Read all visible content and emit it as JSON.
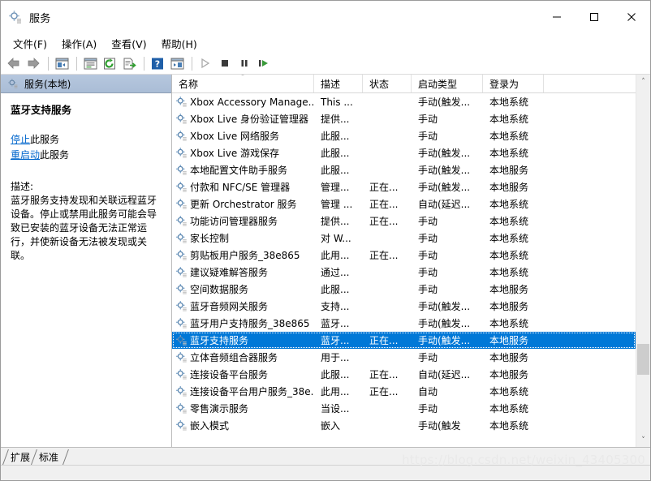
{
  "window": {
    "title": "服务",
    "icon": "services-gear-icon",
    "minimize_label": "—",
    "maximize_label": "☐",
    "close_label": "✕"
  },
  "menubar": [
    {
      "name": "file",
      "label": "文件(F)"
    },
    {
      "name": "action",
      "label": "操作(A)"
    },
    {
      "name": "view",
      "label": "查看(V)"
    },
    {
      "name": "help",
      "label": "帮助(H)"
    }
  ],
  "toolbar": [
    {
      "name": "back-icon",
      "type": "icon"
    },
    {
      "name": "forward-icon",
      "type": "icon"
    },
    {
      "name": "separator",
      "type": "sep"
    },
    {
      "name": "show-hide-tree-icon",
      "type": "icon"
    },
    {
      "name": "separator",
      "type": "sep"
    },
    {
      "name": "properties-icon",
      "type": "icon"
    },
    {
      "name": "refresh-icon",
      "type": "icon"
    },
    {
      "name": "export-list-icon",
      "type": "icon"
    },
    {
      "name": "separator",
      "type": "sep"
    },
    {
      "name": "help-icon",
      "type": "icon"
    },
    {
      "name": "show-action-pane-icon",
      "type": "icon"
    },
    {
      "name": "separator",
      "type": "sep"
    },
    {
      "name": "start-service-icon",
      "type": "icon"
    },
    {
      "name": "stop-service-icon",
      "type": "icon"
    },
    {
      "name": "pause-service-icon",
      "type": "icon"
    },
    {
      "name": "restart-service-icon",
      "type": "icon"
    }
  ],
  "left_pane": {
    "header": "服务(本地)",
    "header_icon": "services-gear-icon",
    "service_title": "蓝牙支持服务",
    "links": [
      {
        "name": "stop-service-link",
        "link_text": "停止",
        "suffix": "此服务"
      },
      {
        "name": "restart-service-link",
        "link_text": "重启动",
        "suffix": "此服务"
      }
    ],
    "description_label": "描述:",
    "description_text": "蓝牙服务支持发现和关联远程蓝牙设备。停止或禁用此服务可能会导致已安装的蓝牙设备无法正常运行，并使新设备无法被发现或关联。"
  },
  "list": {
    "columns": [
      {
        "name": "name",
        "label": "名称",
        "sorted": true
      },
      {
        "name": "description",
        "label": "描述",
        "sorted": false
      },
      {
        "name": "status",
        "label": "状态",
        "sorted": false
      },
      {
        "name": "startup_type",
        "label": "启动类型",
        "sorted": false
      },
      {
        "name": "log_on_as",
        "label": "登录为",
        "sorted": false
      }
    ],
    "sort_indicator": "˄",
    "rows": [
      {
        "name": "Xbox Accessory Manage...",
        "description": "This ...",
        "status": "",
        "startup_type": "手动(触发...",
        "log_on_as": "本地系统",
        "selected": false
      },
      {
        "name": "Xbox Live 身份验证管理器",
        "description": "提供...",
        "status": "",
        "startup_type": "手动",
        "log_on_as": "本地系统",
        "selected": false
      },
      {
        "name": "Xbox Live 网络服务",
        "description": "此服...",
        "status": "",
        "startup_type": "手动",
        "log_on_as": "本地系统",
        "selected": false
      },
      {
        "name": "Xbox Live 游戏保存",
        "description": "此服...",
        "status": "",
        "startup_type": "手动(触发...",
        "log_on_as": "本地系统",
        "selected": false
      },
      {
        "name": "本地配置文件助手服务",
        "description": "此服...",
        "status": "",
        "startup_type": "手动(触发...",
        "log_on_as": "本地服务",
        "selected": false
      },
      {
        "name": "付款和 NFC/SE 管理器",
        "description": "管理...",
        "status": "正在...",
        "startup_type": "手动(触发...",
        "log_on_as": "本地服务",
        "selected": false
      },
      {
        "name": "更新 Orchestrator 服务",
        "description": "管理 ...",
        "status": "正在...",
        "startup_type": "自动(延迟...",
        "log_on_as": "本地系统",
        "selected": false
      },
      {
        "name": "功能访问管理器服务",
        "description": "提供...",
        "status": "正在...",
        "startup_type": "手动",
        "log_on_as": "本地系统",
        "selected": false
      },
      {
        "name": "家长控制",
        "description": "对 W...",
        "status": "",
        "startup_type": "手动",
        "log_on_as": "本地系统",
        "selected": false
      },
      {
        "name": "剪贴板用户服务_38e865",
        "description": "此用...",
        "status": "正在...",
        "startup_type": "手动",
        "log_on_as": "本地系统",
        "selected": false
      },
      {
        "name": "建议疑难解答服务",
        "description": "通过...",
        "status": "",
        "startup_type": "手动",
        "log_on_as": "本地系统",
        "selected": false
      },
      {
        "name": "空间数据服务",
        "description": "此服...",
        "status": "",
        "startup_type": "手动",
        "log_on_as": "本地服务",
        "selected": false
      },
      {
        "name": "蓝牙音频网关服务",
        "description": "支持...",
        "status": "",
        "startup_type": "手动(触发...",
        "log_on_as": "本地服务",
        "selected": false
      },
      {
        "name": "蓝牙用户支持服务_38e865",
        "description": "蓝牙...",
        "status": "",
        "startup_type": "手动(触发...",
        "log_on_as": "本地系统",
        "selected": false
      },
      {
        "name": "蓝牙支持服务",
        "description": "蓝牙...",
        "status": "正在...",
        "startup_type": "手动(触发...",
        "log_on_as": "本地服务",
        "selected": true
      },
      {
        "name": "立体音频组合器服务",
        "description": "用于...",
        "status": "",
        "startup_type": "手动",
        "log_on_as": "本地服务",
        "selected": false
      },
      {
        "name": "连接设备平台服务",
        "description": "此服...",
        "status": "正在...",
        "startup_type": "自动(延迟...",
        "log_on_as": "本地服务",
        "selected": false
      },
      {
        "name": "连接设备平台用户服务_38e...",
        "description": "此用...",
        "status": "正在...",
        "startup_type": "自动",
        "log_on_as": "本地系统",
        "selected": false
      },
      {
        "name": "零售演示服务",
        "description": "当设...",
        "status": "",
        "startup_type": "手动",
        "log_on_as": "本地系统",
        "selected": false
      },
      {
        "name": "嵌入模式",
        "description": "嵌入",
        "status": "",
        "startup_type": "手动(触发",
        "log_on_as": "本地系统",
        "selected": false
      }
    ]
  },
  "scrollbar": {
    "up_arrow": "˄",
    "down_arrow": "˅"
  },
  "tabs": [
    {
      "name": "tab-extended",
      "label": "扩展"
    },
    {
      "name": "tab-standard",
      "label": "标准"
    }
  ],
  "watermark": "https://blog.csdn.net/weixin_43405300"
}
